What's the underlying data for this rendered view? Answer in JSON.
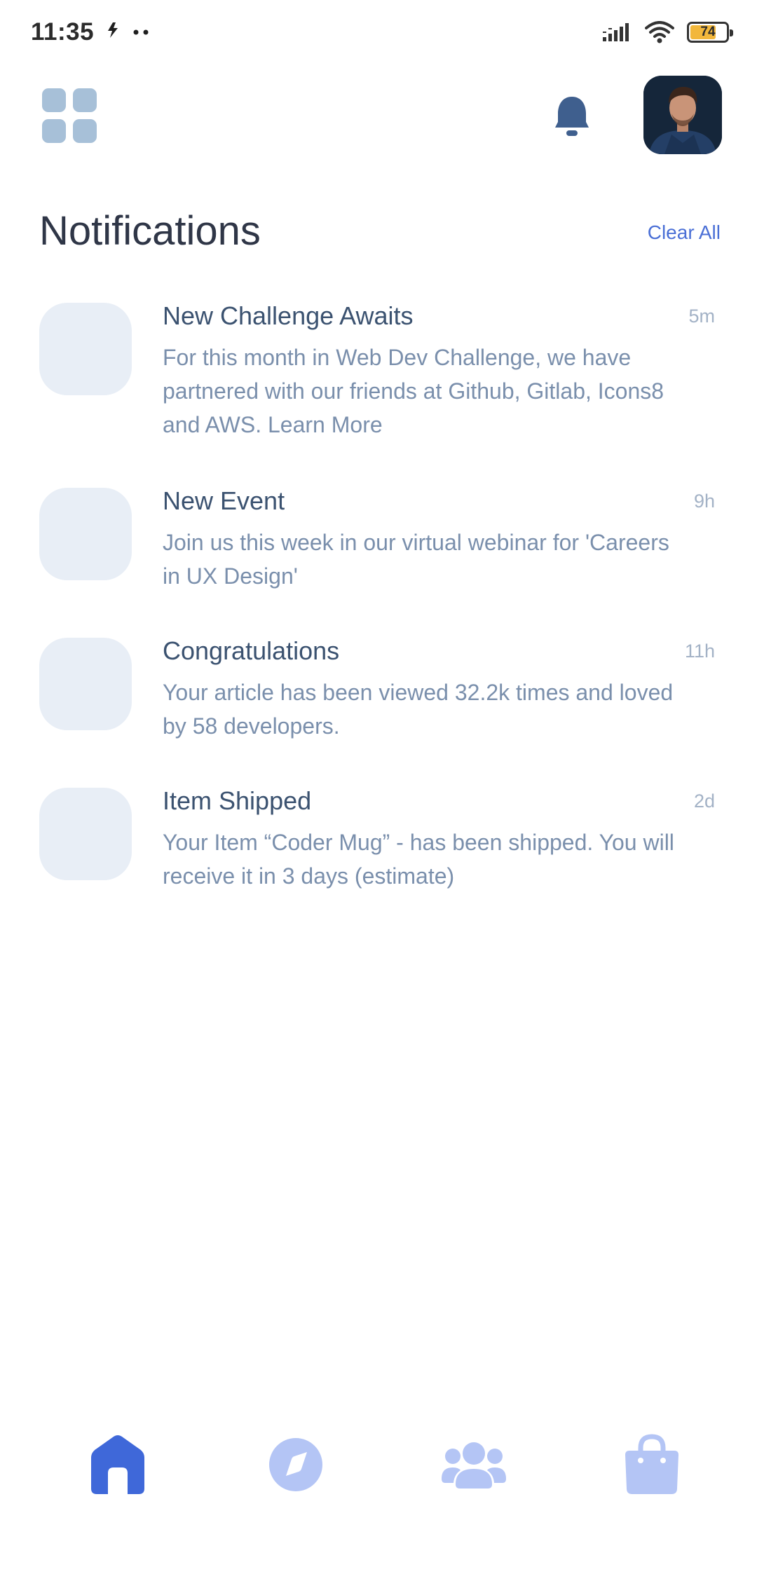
{
  "status_bar": {
    "time": "11:35",
    "battery": "74",
    "battery_level": 0.74,
    "icons": [
      "notification-glyph",
      "dots-icon",
      "signal-icon",
      "wifi-icon",
      "battery-icon"
    ]
  },
  "header": {
    "icons": [
      "menu-grid-icon",
      "bell-icon",
      "avatar"
    ],
    "accent": "#3f68d9",
    "muted_icon": "#a7c0d8",
    "bell_color": "#3f5f8e"
  },
  "page": {
    "title": "Notifications",
    "clear_all": "Clear All"
  },
  "notifications": [
    {
      "title": "New Challenge Awaits",
      "time": "5m",
      "body": "For this month in Web Dev Challenge, we have partnered with our friends at Github, Gitlab, Icons8 and AWS. Learn More"
    },
    {
      "title": "New Event",
      "time": "9h",
      "body": "Join us this week in our virtual webinar for 'Careers in UX Design'"
    },
    {
      "title": "Congratulations",
      "time": "11h",
      "body": "Your article has been viewed 32.2k times and loved by 58 developers."
    },
    {
      "title": "Item Shipped",
      "time": "2d",
      "body": "Your Item “Coder Mug” - has been shipped. You will receive it in 3 days (estimate)"
    }
  ],
  "bottom_nav": {
    "items": [
      "home-icon",
      "compass-icon",
      "community-icon",
      "shopping-bag-icon"
    ],
    "active": "home-icon",
    "active_color": "#3f68d9",
    "inactive_color": "#b4c5f5"
  }
}
